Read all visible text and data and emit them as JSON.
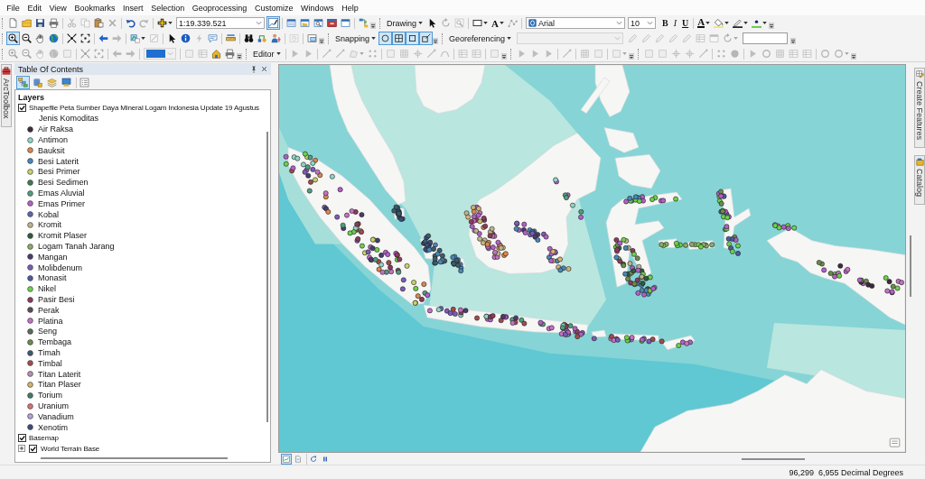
{
  "menu_bar": [
    "File",
    "Edit",
    "View",
    "Bookmarks",
    "Insert",
    "Selection",
    "Geoprocessing",
    "Customize",
    "Windows",
    "Help"
  ],
  "toolbars": [
    {
      "buttons": [
        {
          "disabled": false,
          "on": false
        },
        {
          "disabled": false,
          "on": false
        },
        {
          "disabled": false,
          "on": false
        },
        {
          "disabled": false,
          "on": false
        },
        {
          "disabled": true,
          "on": false
        },
        {
          "disabled": true,
          "on": false
        },
        {
          "disabled": false,
          "on": false
        },
        {
          "disabled": true,
          "on": false
        },
        {
          "disabled": false,
          "on": false
        },
        {
          "disabled": true,
          "on": false
        },
        {
          "disabled": false,
          "on": false
        },
        {
          "disabled": false,
          "on": true
        },
        {
          "disabled": false,
          "on": false
        },
        {
          "disabled": false,
          "on": false
        },
        {
          "disabled": false,
          "on": false
        },
        {
          "disabled": false,
          "on": false
        },
        {
          "disabled": false,
          "on": false
        },
        {
          "disabled": false,
          "on": false
        }
      ],
      "scale": "1:19.339.521"
    },
    {
      "title": "Drawing",
      "buttons": [
        {
          "disabled": false,
          "on": false
        },
        {
          "disabled": true,
          "on": false
        },
        {
          "disabled": true,
          "on": false
        },
        {
          "disabled": false,
          "on": false
        },
        {
          "disabled": true,
          "on": false
        },
        {
          "disabled": false,
          "on": false
        },
        {
          "disabled": false,
          "on": false
        },
        {
          "disabled": false,
          "on": false
        }
      ],
      "text_tool": "A",
      "font": "Arial",
      "font_size": "10",
      "format_buttons": [
        "B",
        "I",
        "U"
      ],
      "font_color": "A"
    },
    {
      "buttons": [
        {
          "disabled": false,
          "on": true
        },
        {
          "disabled": false,
          "on": false
        },
        {
          "disabled": false,
          "on": false
        },
        {
          "disabled": false,
          "on": false
        },
        {
          "disabled": false,
          "on": false
        },
        {
          "disabled": false,
          "on": false
        },
        {
          "disabled": false,
          "on": false
        },
        {
          "disabled": true,
          "on": false
        },
        {
          "disabled": false,
          "on": false
        },
        {
          "disabled": true,
          "on": false
        },
        {
          "disabled": false,
          "on": false
        },
        {
          "disabled": false,
          "on": false
        },
        {
          "disabled": true,
          "on": false
        },
        {
          "disabled": false,
          "on": false
        },
        {
          "disabled": false,
          "on": false
        },
        {
          "disabled": false,
          "on": false
        },
        {
          "disabled": false,
          "on": false
        },
        {
          "disabled": false,
          "on": false
        },
        {
          "disabled": true,
          "on": false
        },
        {
          "disabled": false,
          "on": false
        }
      ]
    },
    {
      "title": "Snapping",
      "buttons": [
        {
          "disabled": false,
          "on": true
        },
        {
          "disabled": false,
          "on": true
        },
        {
          "disabled": false,
          "on": true
        },
        {
          "disabled": false,
          "on": true
        }
      ]
    },
    {
      "title": "Georeferencing",
      "layer_dropdown": {
        "disabled": true
      },
      "buttons": [
        {
          "disabled": true,
          "on": false
        },
        {
          "disabled": true,
          "on": false
        },
        {
          "disabled": true,
          "on": false
        },
        {
          "disabled": true,
          "on": false
        },
        {
          "disabled": true,
          "on": false
        },
        {
          "disabled": true,
          "on": false
        },
        {
          "disabled": true,
          "on": false
        },
        {
          "disabled": true,
          "on": false
        }
      ]
    },
    {
      "zoom_dropdown": {
        "disabled": true
      },
      "buttons": [
        {
          "disabled": true,
          "on": false
        },
        {
          "disabled": true,
          "on": false
        },
        {
          "disabled": true,
          "on": false
        },
        {
          "disabled": true,
          "on": false
        },
        {
          "disabled": true,
          "on": false
        },
        {
          "disabled": true,
          "on": false
        },
        {
          "disabled": true,
          "on": false
        },
        {
          "disabled": true,
          "on": false
        },
        {
          "disabled": true,
          "on": false
        },
        {
          "disabled": true,
          "on": false
        },
        {
          "disabled": true,
          "on": false
        },
        {
          "disabled": false,
          "on": false
        },
        {
          "disabled": false,
          "on": false
        }
      ]
    },
    {
      "title": "Editor",
      "buttons": [
        {
          "disabled": true,
          "on": false
        },
        {
          "disabled": true,
          "on": false
        },
        {
          "disabled": true,
          "on": false
        },
        {
          "disabled": true,
          "on": false
        },
        {
          "disabled": true,
          "on": false
        },
        {
          "disabled": true,
          "on": false
        },
        {
          "disabled": true,
          "on": false
        },
        {
          "disabled": true,
          "on": false
        },
        {
          "disabled": true,
          "on": false
        },
        {
          "disabled": true,
          "on": false
        },
        {
          "disabled": true,
          "on": false
        },
        {
          "disabled": true,
          "on": false
        },
        {
          "disabled": true,
          "on": false
        },
        {
          "disabled": true,
          "on": false
        }
      ]
    },
    {
      "buttons": [
        {
          "disabled": true,
          "on": false
        },
        {
          "disabled": true,
          "on": false
        },
        {
          "disabled": true,
          "on": false
        },
        {
          "disabled": true,
          "on": false
        },
        {
          "disabled": true,
          "on": false
        },
        {
          "disabled": true,
          "on": false
        },
        {
          "disabled": true,
          "on": false
        }
      ]
    },
    {
      "buttons": [
        {
          "disabled": true,
          "on": false
        },
        {
          "disabled": true,
          "on": false
        },
        {
          "disabled": true,
          "on": false
        },
        {
          "disabled": true,
          "on": false
        },
        {
          "disabled": true,
          "on": false
        },
        {
          "disabled": true,
          "on": false
        },
        {
          "disabled": true,
          "on": false
        },
        {
          "disabled": true,
          "on": false
        },
        {
          "disabled": true,
          "on": false
        },
        {
          "disabled": true,
          "on": false
        },
        {
          "disabled": true,
          "on": false
        },
        {
          "disabled": true,
          "on": false
        },
        {
          "disabled": true,
          "on": false
        },
        {
          "disabled": true,
          "on": false
        }
      ]
    }
  ],
  "left_dock": {
    "tab": "ArcToolbox"
  },
  "toc": {
    "title": "Table Of Contents",
    "view_buttons": [
      {
        "selected": true
      },
      {
        "selected": false
      },
      {
        "selected": false
      },
      {
        "selected": false
      }
    ],
    "root": "Layers",
    "layers": [
      {
        "name": "Shapefile Peta Sumber Daya Mineral Logam Indonesia Update 19 Agustus",
        "checked": true,
        "legend_heading": "Jenis Komoditas",
        "legend": [
          {
            "label": "Air Raksa",
            "color": "#3b2d3a"
          },
          {
            "label": "Antimon",
            "color": "#8ed6c8"
          },
          {
            "label": "Bauksit",
            "color": "#d9894f"
          },
          {
            "label": "Besi Laterit",
            "color": "#4a86b8"
          },
          {
            "label": "Besi Primer",
            "color": "#c9d46b"
          },
          {
            "label": "Besi Sedimen",
            "color": "#3f7d4c"
          },
          {
            "label": "Emas Aluvial",
            "color": "#4f9e82"
          },
          {
            "label": "Emas Primer",
            "color": "#b45fc9"
          },
          {
            "label": "Kobal",
            "color": "#5b66ad"
          },
          {
            "label": "Kromit",
            "color": "#bdb48e"
          },
          {
            "label": "Kromit Plaser",
            "color": "#2f5c3c"
          },
          {
            "label": "Logam Tanah Jarang",
            "color": "#8bab6b"
          },
          {
            "label": "Mangan",
            "color": "#4d3b6e"
          },
          {
            "label": "Molibdenum",
            "color": "#7b5cbb"
          },
          {
            "label": "Monasit",
            "color": "#4c5ca2"
          },
          {
            "label": "Nikel",
            "color": "#6dd14c"
          },
          {
            "label": "Pasir Besi",
            "color": "#8c3b5c"
          },
          {
            "label": "Perak",
            "color": "#5c4b5c"
          },
          {
            "label": "Platina",
            "color": "#c472c4"
          },
          {
            "label": "Seng",
            "color": "#5c6b5c"
          },
          {
            "label": "Tembaga",
            "color": "#6c8c4c"
          },
          {
            "label": "Timah",
            "color": "#3c5c6c"
          },
          {
            "label": "Timbal",
            "color": "#a34c4c"
          },
          {
            "label": "Titan Laterit",
            "color": "#b392b3"
          },
          {
            "label": "Titan Plaser",
            "color": "#d3b373"
          },
          {
            "label": "Torium",
            "color": "#3c7c6c"
          },
          {
            "label": "Uranium",
            "color": "#d37373"
          },
          {
            "label": "Vanadium",
            "color": "#b3a3d3"
          },
          {
            "label": "Xenotim",
            "color": "#3c4c7c"
          }
        ]
      },
      {
        "name": "Basemap",
        "checked": true,
        "children": [
          {
            "name": "World Terrain Base",
            "checked": true,
            "expanded": false
          }
        ]
      }
    ]
  },
  "map_view_buttons": [
    {
      "selected": true
    },
    {
      "selected": false
    }
  ],
  "right_dock": {
    "tabs": [
      "Create Features",
      "Catalog"
    ]
  },
  "status_bar": {
    "coordinates": "96,299  6,955 Decimal Degrees"
  }
}
